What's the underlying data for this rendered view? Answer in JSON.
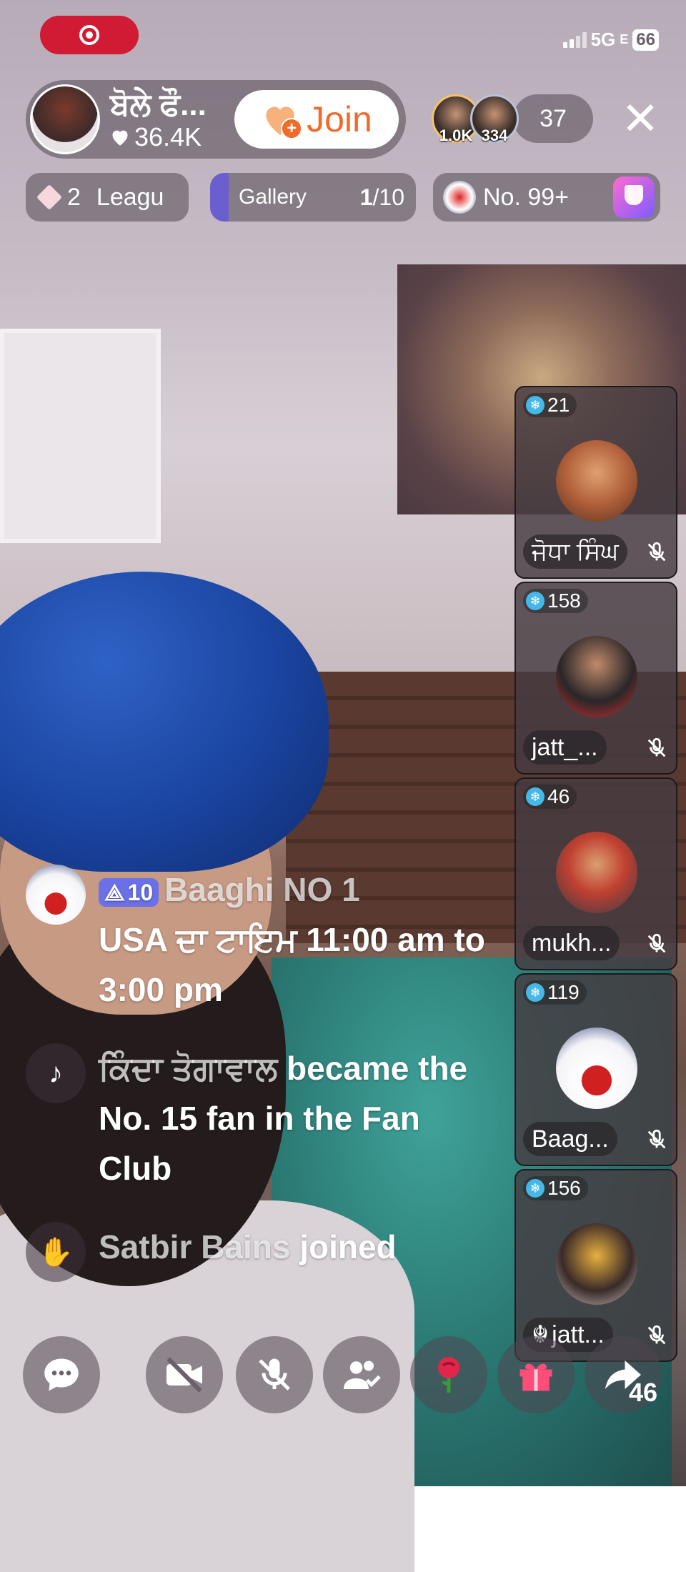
{
  "status": {
    "network": "5G",
    "network_suffix": "E",
    "battery": "66"
  },
  "host": {
    "name": "ਬੋਲੇ ਫੌ...",
    "likes": "36.4K",
    "join_label": "Join"
  },
  "viewers": {
    "top1_badge": "1.0K",
    "top2_badge": "334",
    "count": "37"
  },
  "pills": {
    "league_count": "2",
    "league_label": "Leagu",
    "gallery_label": "Gallery",
    "gallery_current": "1",
    "gallery_total": "/10",
    "rank_label": "No. 99+"
  },
  "guests": [
    {
      "score": "21",
      "name": "ਜੋਧਾ ਸਿੰਘ"
    },
    {
      "score": "158",
      "name": "jatt_..."
    },
    {
      "score": "46",
      "name": "mukh..."
    },
    {
      "score": "119",
      "name": "Baag..."
    },
    {
      "score": "156",
      "name": "jatt..."
    }
  ],
  "chat": {
    "msg1_level": "10",
    "msg1_user": "Baaghi NO 1",
    "msg1_text": "USA ਦਾ ਟਾਇਮ 11:00 am to 3:00 pm",
    "msg2_user": "ਕਿੰਦਾ ਤੋਗਾਵਾਲ",
    "msg2_text": " became the No. 15 fan in the Fan Club",
    "msg3_user": "Satbir Bains",
    "msg3_text": " joined"
  },
  "toolbar": {
    "share_count": "46"
  },
  "colors": {
    "live_red": "#d11a34",
    "join_orange": "#f06a2a",
    "level_badge": "#6a70e8",
    "gift_pink": "#ff4d7a"
  }
}
